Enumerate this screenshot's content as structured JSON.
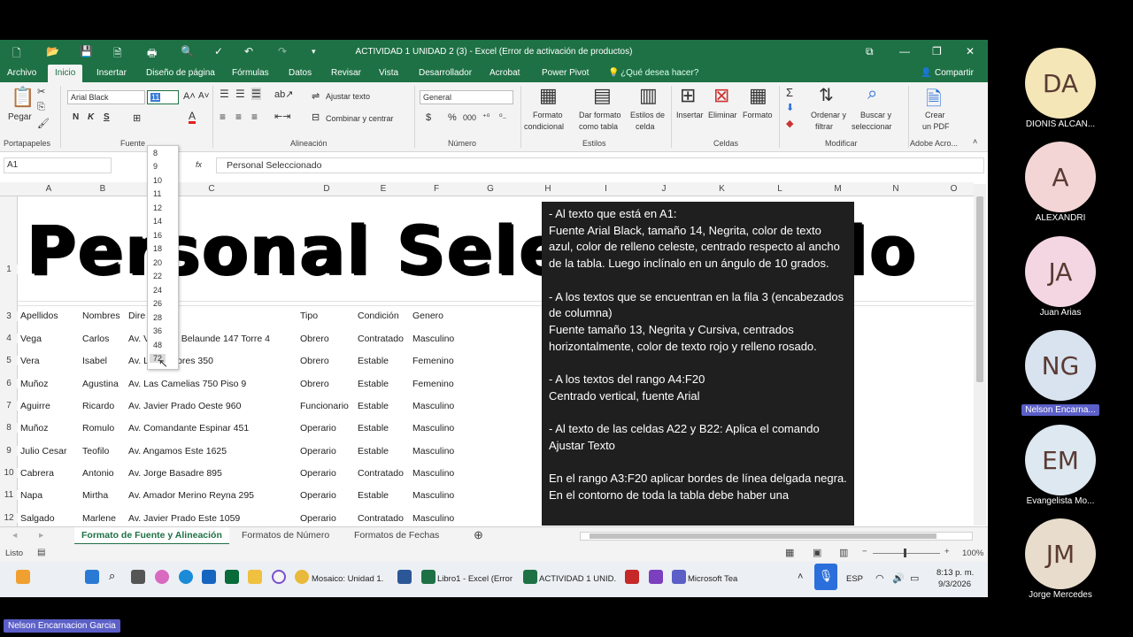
{
  "window": {
    "title": "ACTIVIDAD 1 UNIDAD 2 (3) - Excel (Error de activación de productos)",
    "controls": [
      "⧉",
      "—",
      "❐",
      "✕"
    ]
  },
  "tabs": [
    "Archivo",
    "Inicio",
    "Insertar",
    "Diseño de página",
    "Fórmulas",
    "Datos",
    "Revisar",
    "Vista",
    "Desarrollador",
    "Acrobat",
    "Power Pivot",
    "¿Qué desea hacer?"
  ],
  "share_label": "Compartir",
  "ribbon": {
    "paste": "Pegar",
    "font_name": "Arial Black",
    "font_size": "11",
    "bold": "N",
    "italic": "K",
    "underline": "S",
    "wrap_text": "Ajustar texto",
    "merge_center": "Combinar y centrar",
    "number_format": "General",
    "percent": "%",
    "thousands": "000",
    "currency": "$",
    "conditional_format": [
      "Formato",
      "condicional"
    ],
    "format_table": [
      "Dar formato",
      "como tabla"
    ],
    "cell_styles": [
      "Estilos de",
      "celda"
    ],
    "insert": "Insertar",
    "delete": "Eliminar",
    "format": "Formato",
    "sort_filter": [
      "Ordenar y",
      "filtrar"
    ],
    "find_select": [
      "Buscar y",
      "seleccionar"
    ],
    "create_pdf": [
      "Crear",
      "un PDF"
    ],
    "groups": [
      "Portapapeles",
      "Fuente",
      "Alineación",
      "Número",
      "Estilos",
      "Celdas",
      "Modificar",
      "Adobe Acro..."
    ]
  },
  "formula_bar": {
    "name_box": "A1",
    "fx": "fx",
    "content": "Personal Seleccionado"
  },
  "columns": [
    "A",
    "B",
    "C",
    "D",
    "E",
    "F",
    "G",
    "H",
    "I",
    "J",
    "K",
    "L",
    "M",
    "N",
    "O"
  ],
  "row_numbers": [
    "1",
    "3",
    "4",
    "5",
    "6",
    "7",
    "8",
    "9",
    "10",
    "11",
    "12"
  ],
  "title_cell": "Personal Seleccionado",
  "headers": [
    "Apellidos",
    "Nombres",
    "Dire",
    "Tipo",
    "Condición",
    "Genero"
  ],
  "rows": [
    [
      "Vega",
      "Carlos",
      "Av. Víctor A. Belaunde 147 Torre 4",
      "Obrero",
      "Contratado",
      "Masculino"
    ],
    [
      "Vera",
      "Isabel",
      "Av. Libertadores 350",
      "Obrero",
      "Estable",
      "Femenino"
    ],
    [
      "Muñoz",
      "Agustina",
      "Av. Las Camelias 750 Piso 9",
      "Obrero",
      "Estable",
      "Femenino"
    ],
    [
      "Aguirre",
      "Ricardo",
      "Av. Javier Prado Oeste 960",
      "Funcionario",
      "Estable",
      "Masculino"
    ],
    [
      "Muñoz",
      "Romulo",
      "Av. Comandante Espinar 451",
      "Operario",
      "Estable",
      "Masculino"
    ],
    [
      "Julio Cesar",
      "Teofilo",
      "Av. Angamos Este 1625",
      "Operario",
      "Estable",
      "Masculino"
    ],
    [
      "Cabrera",
      "Antonio",
      "Av. Jorge  Basadre 895",
      "Operario",
      "Contratado",
      "Masculino"
    ],
    [
      "Napa",
      "Mirtha",
      "Av. Amador Merino Reyna 295",
      "Operario",
      "Estable",
      "Masculino"
    ],
    [
      "Salgado",
      "Marlene",
      "Av. Javier Prado Este 1059",
      "Operario",
      "Contratado",
      "Masculino"
    ]
  ],
  "font_sizes": [
    "8",
    "9",
    "10",
    "11",
    "12",
    "14",
    "16",
    "18",
    "20",
    "22",
    "24",
    "26",
    "28",
    "36",
    "48",
    "72"
  ],
  "note_text": [
    "- Al texto que está en A1:\nFuente Arial Black, tamaño 14, Negrita, color de texto azul, color de relleno celeste, centrado respecto al ancho de la tabla. Luego inclínalo en un ángulo de 10 grados.",
    "- A los textos que se encuentran en la fila 3 (encabezados de columna)\nFuente tamaño 13, Negrita y Cursiva, centrados horizontalmente, color de texto rojo y relleno rosado.",
    "- A los textos del rango A4:F20\nCentrado vertical, fuente Arial",
    "- Al texto de las celdas A22 y B22: Aplica el comando Ajustar Texto",
    "En el rango A3:F20 aplicar bordes de línea delgada negra. En el contorno de toda la tabla debe haber una"
  ],
  "sheet_tabs": [
    "Formato de Fuente y Alineación",
    "Formatos de Número",
    "Formatos de Fechas"
  ],
  "status": {
    "ready": "Listo",
    "zoom": "100%"
  },
  "taskbar": {
    "items": [
      "Mosaico: Unidad 1.",
      "Libro1 - Excel (Error",
      "ACTIVIDAD 1 UNID.",
      "Microsoft Tea"
    ],
    "lang": "ESP",
    "time": "8:13 p. m.",
    "date": "9/3/2026"
  },
  "participants": [
    {
      "initials": "DA",
      "name": "DIONIS ALCAN...",
      "color": "#f5e6b8"
    },
    {
      "initials": "A",
      "name": "ALEXANDRI",
      "color": "#f3d5d5"
    },
    {
      "initials": "JA",
      "name": "Juan Arias",
      "color": "#f4d6e2"
    },
    {
      "initials": "NG",
      "name": "Nelson Encarna...",
      "color": "#d9e3ef"
    },
    {
      "initials": "EM",
      "name": "Evangelista Mo...",
      "color": "#dde8f0"
    },
    {
      "initials": "JM",
      "name": "Jorge Mercedes",
      "color": "#e8dccc"
    }
  ],
  "presenter_name": "Nelson Encarnacion Garcia"
}
